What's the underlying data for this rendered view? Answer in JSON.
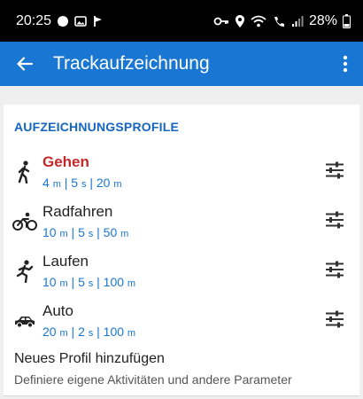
{
  "status_bar": {
    "time": "20:25",
    "battery": "28%",
    "left_icons": [
      "chat-bubble-icon",
      "image-icon",
      "flag-icon"
    ],
    "right_icons": [
      "key-icon",
      "location-icon",
      "wifi-call-icon",
      "wifi-icon",
      "signal-icon",
      "battery-icon"
    ]
  },
  "app_bar": {
    "title": "Trackaufzeichnung",
    "back_icon": "arrow-back-icon",
    "menu_icon": "more-vert-icon",
    "color": "#1976d2"
  },
  "section": {
    "title": "AUFZEICHNUNGSPROFILE"
  },
  "profiles": [
    {
      "name": "Gehen",
      "active": true,
      "icon": "walking-icon",
      "v1": "4",
      "u1": "m",
      "v2": "5",
      "u2": "s",
      "v3": "20",
      "u3": "m"
    },
    {
      "name": "Radfahren",
      "active": false,
      "icon": "bicycle-icon",
      "v1": "10",
      "u1": "m",
      "v2": "5",
      "u2": "s",
      "v3": "50",
      "u3": "m"
    },
    {
      "name": "Laufen",
      "active": false,
      "icon": "running-icon",
      "v1": "10",
      "u1": "m",
      "v2": "5",
      "u2": "s",
      "v3": "100",
      "u3": "m"
    },
    {
      "name": "Auto",
      "active": false,
      "icon": "car-icon",
      "v1": "20",
      "u1": "m",
      "v2": "2",
      "u2": "s",
      "v3": "100",
      "u3": "m"
    }
  ],
  "new_profile": {
    "title": "Neues Profil hinzufügen",
    "subtitle": "Definiere eigene Aktivitäten und andere Parameter"
  },
  "colors": {
    "accent": "#1976d2",
    "active_profile": "#c62828",
    "section_title": "#1565c0"
  }
}
